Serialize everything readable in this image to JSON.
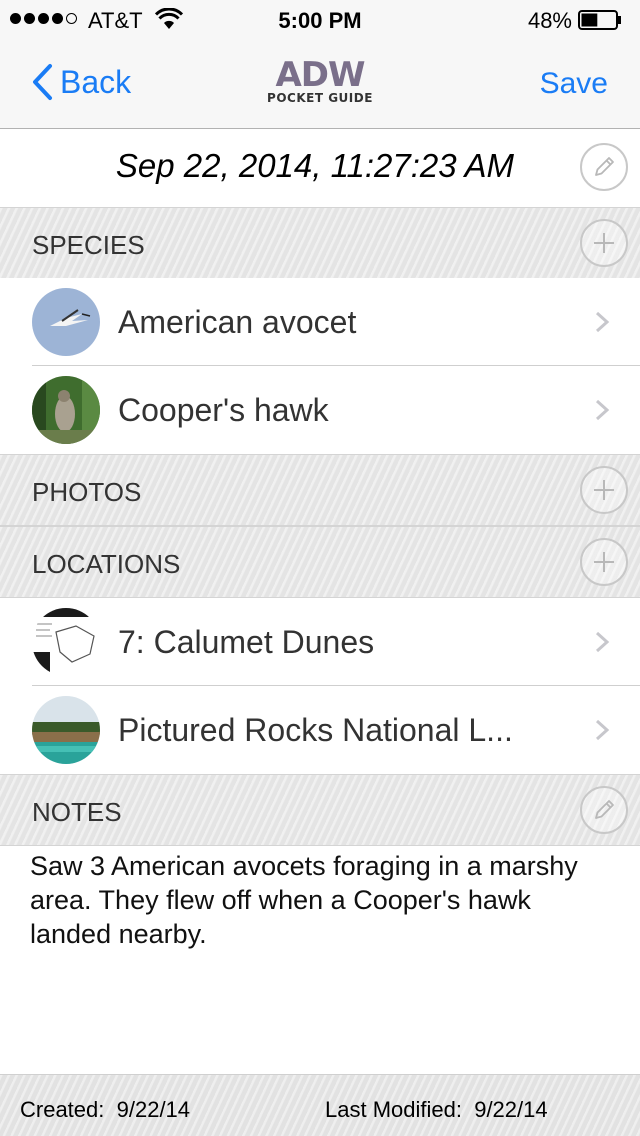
{
  "status_bar": {
    "carrier": "AT&T",
    "time": "5:00 PM",
    "battery_percent": "48%",
    "signal_bars": 4,
    "signal_max": 5,
    "battery_level": 0.48
  },
  "nav": {
    "back_label": "Back",
    "save_label": "Save",
    "logo_main": "ADW",
    "logo_sub": "POCKET GUIDE"
  },
  "observation": {
    "datetime": "Sep 22, 2014, 11:27:23 AM"
  },
  "sections": {
    "species": {
      "label": "SPECIES",
      "items": [
        {
          "name": "American avocet"
        },
        {
          "name": "Cooper's hawk"
        }
      ]
    },
    "photos": {
      "label": "PHOTOS"
    },
    "locations": {
      "label": "LOCATIONS",
      "items": [
        {
          "name": "7: Calumet Dunes"
        },
        {
          "name": "Pictured Rocks National L..."
        }
      ]
    },
    "notes": {
      "label": "NOTES",
      "text": "Saw 3 American avocets foraging in a marshy area. They flew off when a Cooper's hawk landed nearby."
    }
  },
  "footer": {
    "created_label": "Created:",
    "created_date": "9/22/14",
    "modified_label": "Last Modified:",
    "modified_date": "9/22/14"
  },
  "colors": {
    "accent": "#1a7cf5",
    "section_bg": "#e9e9e9"
  }
}
